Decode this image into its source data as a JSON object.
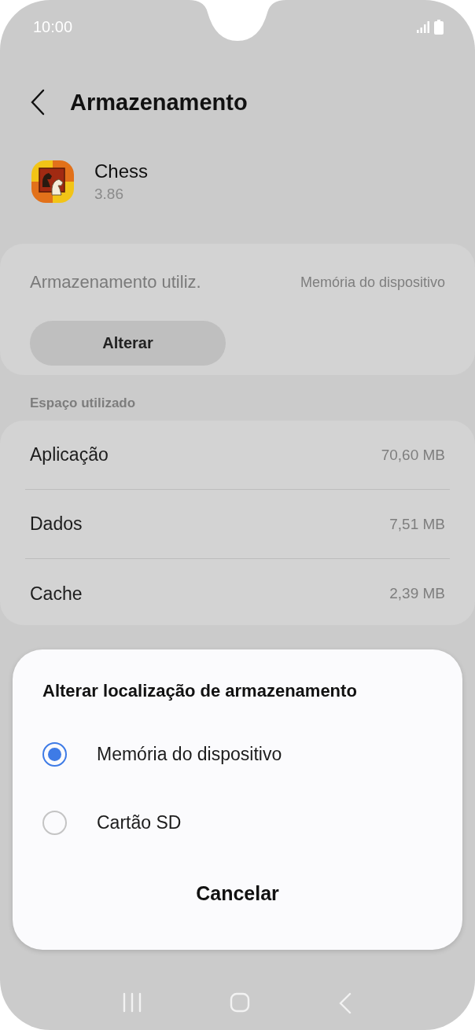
{
  "status_bar": {
    "time": "10:00"
  },
  "header": {
    "title": "Armazenamento"
  },
  "app": {
    "name": "Chess",
    "version": "3.86"
  },
  "storage_location": {
    "label": "Armazenamento utiliz.",
    "value": "Memória do dispositivo",
    "button": "Alterar"
  },
  "section_title": "Espaço utilizado",
  "usage_rows": [
    {
      "label": "Aplicação",
      "value": "70,60 MB"
    },
    {
      "label": "Dados",
      "value": "7,51 MB"
    },
    {
      "label": "Cache",
      "value": "2,39 MB"
    }
  ],
  "dialog": {
    "title": "Alterar localização de armazenamento",
    "options": [
      {
        "label": "Memória do dispositivo",
        "selected": true
      },
      {
        "label": "Cartão SD",
        "selected": false
      }
    ],
    "cancel": "Cancelar"
  }
}
